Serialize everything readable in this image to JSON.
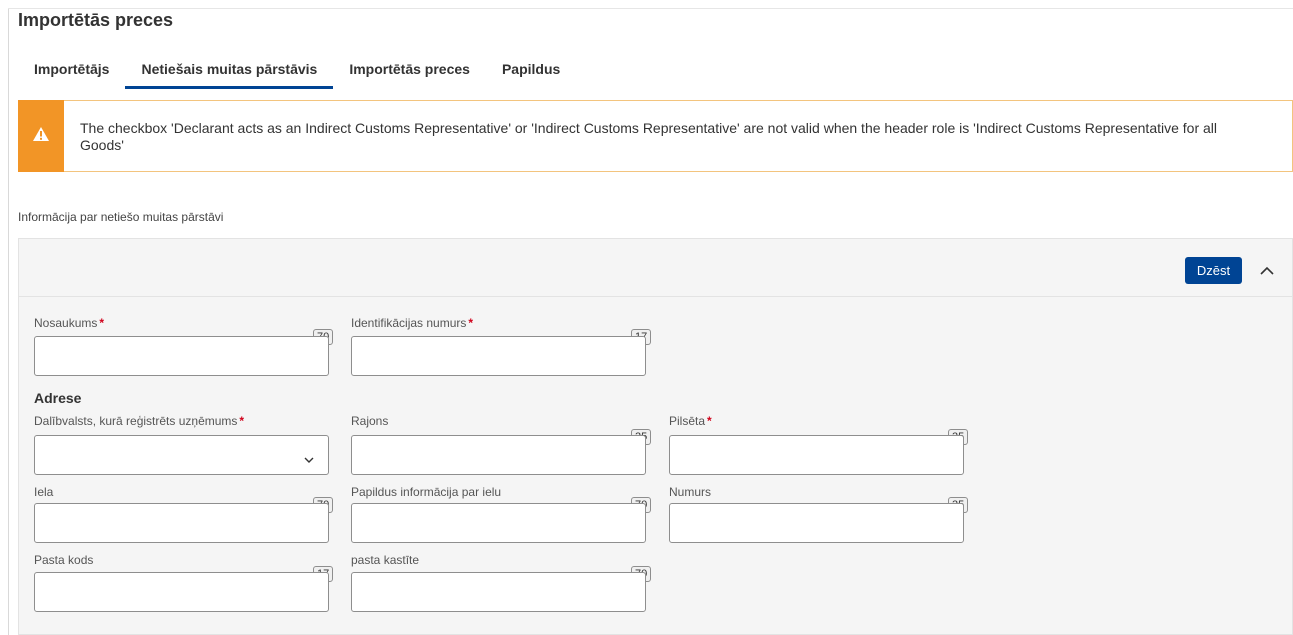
{
  "page_title": "Importētās preces",
  "tabs": [
    {
      "label": "Importētājs",
      "active": false
    },
    {
      "label": "Netiešais muitas pārstāvis",
      "active": true
    },
    {
      "label": "Importētās preces",
      "active": false
    },
    {
      "label": "Papildus",
      "active": false
    }
  ],
  "alert": {
    "icon": "warning-icon",
    "text": "The checkbox 'Declarant acts as an Indirect Customs Representative' or 'Indirect Customs Representative' are not valid when the header role is 'Indirect Customs Representative for all Goods'"
  },
  "section_label": "Informācija par netiešo muitas pārstāvi",
  "panel": {
    "delete_label": "Dzēst",
    "collapse_icon": "chevron-up-icon"
  },
  "fields": {
    "name": {
      "label": "Nosaukums",
      "required": "*",
      "counter": "70",
      "value": ""
    },
    "id_number": {
      "label": "Identifikācijas numurs",
      "required": "*",
      "counter": "17",
      "value": ""
    },
    "address_title": "Adrese",
    "member_state": {
      "label": "Dalībvalsts, kurā reģistrēts uzņēmums",
      "required": "*",
      "value": ""
    },
    "district": {
      "label": "Rajons",
      "counter": "35",
      "value": ""
    },
    "city": {
      "label": "Pilsēta",
      "required": "*",
      "counter": "35",
      "value": ""
    },
    "street": {
      "label": "Iela",
      "counter": "70",
      "value": ""
    },
    "street_extra": {
      "label": "Papildus informācija par ielu",
      "counter": "70",
      "value": ""
    },
    "number": {
      "label": "Numurs",
      "counter": "35",
      "value": ""
    },
    "postcode": {
      "label": "Pasta kods",
      "counter": "17",
      "value": ""
    },
    "po_box": {
      "label": "pasta kastīte",
      "counter": "70",
      "value": ""
    }
  },
  "colors": {
    "accent": "#004494",
    "warning": "#f29526",
    "required": "#d0021b"
  }
}
